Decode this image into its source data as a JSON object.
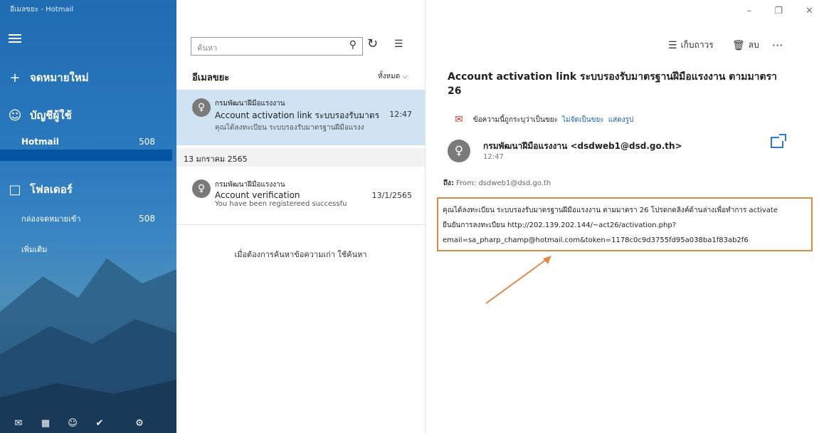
{
  "window": {
    "title": "อีเมลขยะ - Hotmail"
  },
  "sidebar": {
    "new_mail_label": "จดหมายใหม่",
    "accounts_label": "บัญชีผู้ใช้",
    "account_name": "Hotmail",
    "account_count": "508",
    "folders_label": "โฟลเดอร์",
    "inbox_label": "กล่องจดหมายเข้า",
    "inbox_count": "508",
    "more_label": "เพิ่มเติม"
  },
  "list": {
    "search_placeholder": "ค้นหา",
    "title": "อีเมลขยะ",
    "filter_label": "ทั้งหมด",
    "messages": [
      {
        "sender": "กรมพัฒนาฝีมือแรงงาน",
        "subject": "Account activation link ระบบรองรับมาตรฐาน",
        "time": "12:47",
        "preview": "คุณได้ลงทะเบียน ระบบรองรับมาตรฐานฝีมือแรงง"
      },
      {
        "sender": "กรมพัฒนาฝีมือแรงงาน",
        "subject": "Account verification",
        "time": "13/1/2565",
        "preview": "You have been registereed successfu"
      }
    ],
    "date_separator": "13 มกราคม 2565",
    "older_hint": "เมื่อต้องการค้นหาข้อความเก่า ใช้ค้นหา"
  },
  "reader": {
    "toolbar": {
      "archive_label": "เก็บถาวร",
      "delete_label": "ลบ",
      "more_label": "···"
    },
    "subject": "Account activation link ระบบรองรับมาตรฐานฝีมือแรงงาน ตามมาตรา 26",
    "junk_notice": "ข้อความนี้ถูกระบุว่าเป็นขยะ",
    "not_junk_link": "ไม่จัดเป็นขยะ",
    "show_images_link": "แสดงรูป",
    "sender": "กรมพัฒนาฝีมือแรงงาน <dsdweb1@dsd.go.th>",
    "time": "12:47",
    "to_label": "ถึง:",
    "to_value": "From: dsdweb1@dsd.go.th",
    "body_line1": "คุณได้ลงทะเบียน ระบบรองรับมาตรฐานฝีมือแรงงาน ตามมาตรา 26 โปรดกดลิงค์ด้านล่างเพื่อทำการ activate",
    "body_line2": "ยืนยันการลงทะเบียน http://202.139.202.144/~act26/activation.php?",
    "body_line3": "email=sa_pharp_champ@hotmail.com&token=1178c0c9d3755fd95a038ba1f83ab2f6"
  },
  "colors": {
    "accent": "#1f6cb3",
    "selection": "#cfe3f3",
    "highlight_box": "#d98b45"
  }
}
